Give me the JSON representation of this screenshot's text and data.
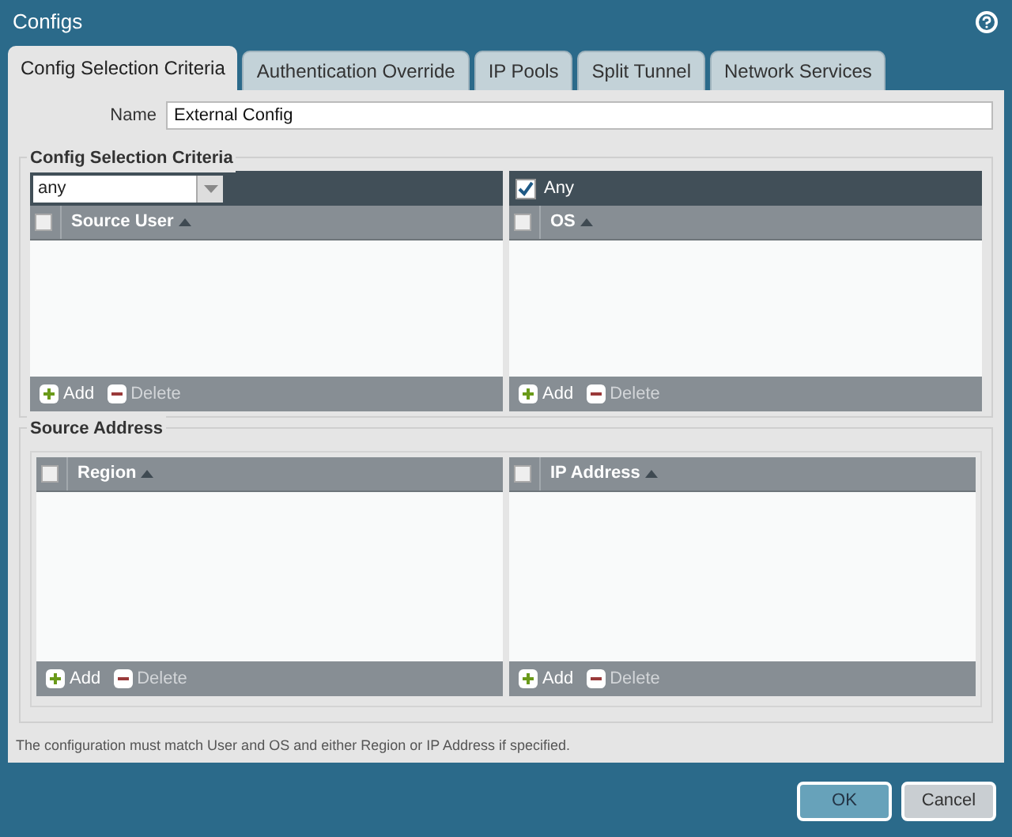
{
  "window": {
    "title": "Configs"
  },
  "tabs": [
    {
      "label": "Config Selection Criteria",
      "selected": true
    },
    {
      "label": "Authentication Override",
      "selected": false
    },
    {
      "label": "IP Pools",
      "selected": false
    },
    {
      "label": "Split Tunnel",
      "selected": false
    },
    {
      "label": "Network Services",
      "selected": false
    }
  ],
  "name_field": {
    "label": "Name",
    "value": "External Config"
  },
  "sections": [
    {
      "legend": "Config Selection Criteria",
      "grids": [
        {
          "filter": {
            "kind": "dropdown",
            "value": "any"
          },
          "column": "Source User",
          "select_all_checked": false,
          "actions": [
            {
              "label": "Add",
              "kind": "add",
              "disabled": false
            },
            {
              "label": "Delete",
              "kind": "delete",
              "disabled": true
            }
          ]
        },
        {
          "filter": {
            "kind": "checkbox",
            "label": "Any",
            "checked": true
          },
          "column": "OS",
          "select_all_checked": false,
          "actions": [
            {
              "label": "Add",
              "kind": "add",
              "disabled": false
            },
            {
              "label": "Delete",
              "kind": "delete",
              "disabled": true
            }
          ]
        }
      ]
    },
    {
      "legend": "Source Address",
      "grids": [
        {
          "column": "Region",
          "select_all_checked": false,
          "actions": [
            {
              "label": "Add",
              "kind": "add",
              "disabled": false
            },
            {
              "label": "Delete",
              "kind": "delete",
              "disabled": true
            }
          ]
        },
        {
          "column": "IP Address",
          "select_all_checked": false,
          "actions": [
            {
              "label": "Add",
              "kind": "add",
              "disabled": false
            },
            {
              "label": "Delete",
              "kind": "delete",
              "disabled": true
            }
          ]
        }
      ]
    }
  ],
  "note": "The configuration must match User and OS and either Region or IP Address if specified.",
  "buttons": [
    {
      "label": "OK",
      "kind": "primary"
    },
    {
      "label": "Cancel",
      "kind": "secondary"
    }
  ]
}
